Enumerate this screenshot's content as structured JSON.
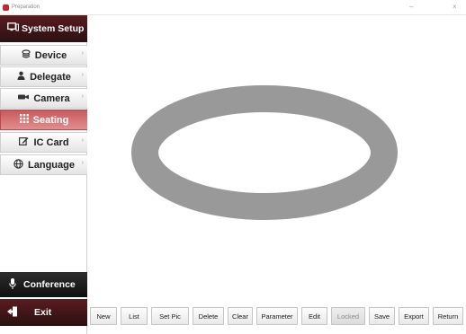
{
  "window": {
    "title": "Preparation",
    "icon": "app-logo-icon",
    "minimize_glyph": "–",
    "close_glyph": "×"
  },
  "sidebar": {
    "header": {
      "label": "System Setup",
      "icon": "monitor-icon"
    },
    "items": [
      {
        "label": "Device",
        "icon": "layers-icon",
        "active": false
      },
      {
        "label": "Delegate",
        "icon": "person-icon",
        "active": false
      },
      {
        "label": "Camera",
        "icon": "camera-icon",
        "active": false
      },
      {
        "label": "Seating",
        "icon": "grid-icon",
        "active": true
      },
      {
        "label": "IC Card",
        "icon": "edit-card-icon",
        "active": false
      },
      {
        "label": "Language",
        "icon": "globe-icon",
        "active": false
      }
    ],
    "conference": {
      "label": "Conference",
      "icon": "microphone-icon"
    },
    "exit": {
      "label": "Exit",
      "icon": "exit-door-icon"
    }
  },
  "canvas": {
    "shape": "ellipse-ring",
    "ring_color": "#999999"
  },
  "toolbar": {
    "buttons": [
      {
        "label": "New",
        "enabled": true
      },
      {
        "label": "List",
        "enabled": true
      },
      {
        "label": "Set Pic",
        "enabled": true
      },
      {
        "label": "Delete",
        "enabled": true
      },
      {
        "label": "Clear",
        "enabled": true
      },
      {
        "label": "Parameter",
        "enabled": true
      },
      {
        "label": "Edit",
        "enabled": true
      },
      {
        "label": "Locked",
        "enabled": false
      },
      {
        "label": "Save",
        "enabled": true
      },
      {
        "label": "Export",
        "enabled": true
      },
      {
        "label": "Return",
        "enabled": true
      }
    ]
  },
  "colors": {
    "header_dark_red": "#3d1416",
    "active_item_red": "#d47274",
    "conference_dark": "#1c1c1c"
  }
}
